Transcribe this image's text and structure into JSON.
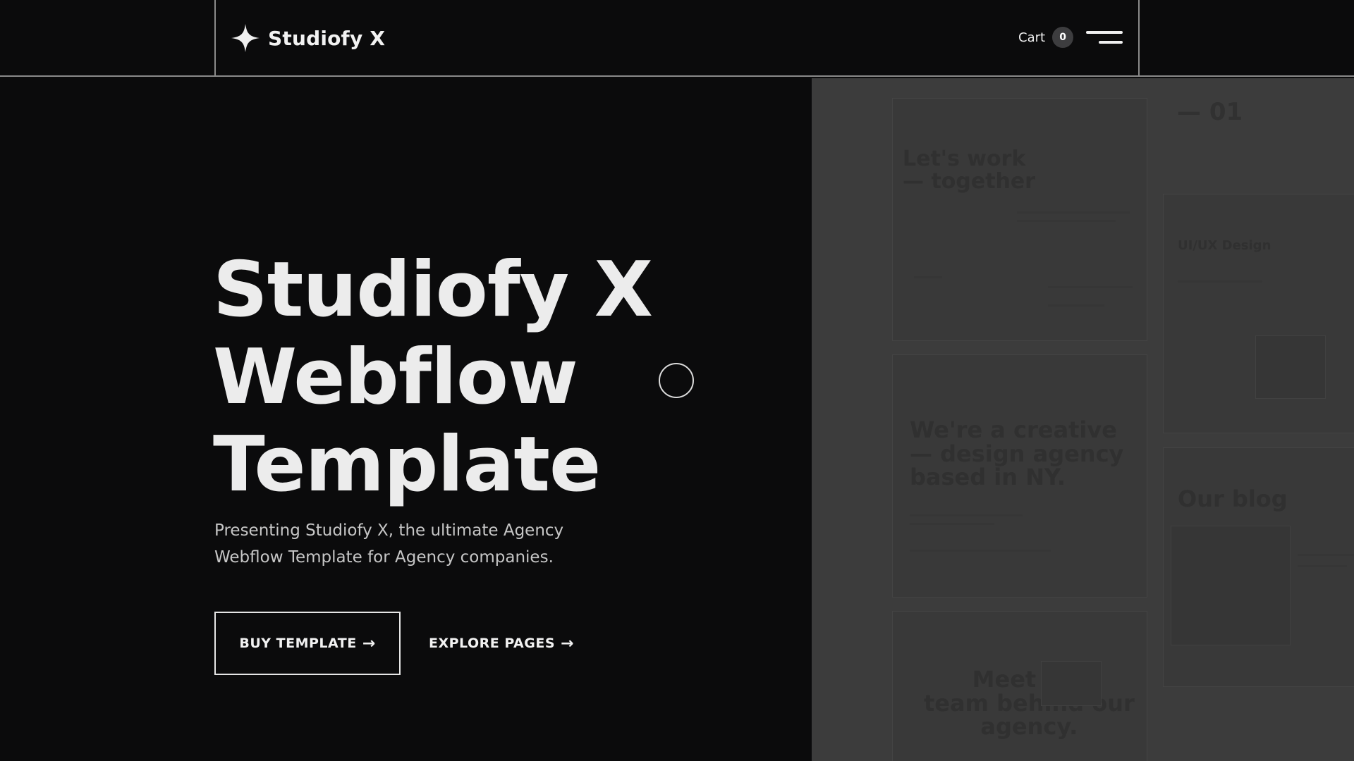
{
  "brand": {
    "name": "Studiofy X",
    "logo_icon": "four-point-star-icon"
  },
  "header": {
    "cart_label": "Cart",
    "cart_count": "0",
    "menu_icon": "hamburger-menu-icon"
  },
  "hero": {
    "title_lines": [
      "Studiofy X",
      "Webflow",
      "Template"
    ],
    "subtitle_lines": [
      "Presenting Studiofy X, the ultimate Agency",
      "Webflow Template for Agency companies."
    ],
    "buy_label": "BUY TEMPLATE",
    "explore_label": "EXPLORE PAGES",
    "arrow": "→"
  },
  "preview": {
    "card_1_title_lines": [
      "Let's work",
      "— together"
    ],
    "card_2_title_lines": [
      "We're a creative",
      "— design agency",
      "based in NY."
    ],
    "card_3_title_lines": [
      "Meet the",
      "team behind our",
      "agency."
    ],
    "side_number": "— 01",
    "side_service": "UI/UX Design",
    "side_blog_title": "Our blog"
  },
  "colors": {
    "background": "#0b0b0c",
    "panel": "#3c3c3c",
    "text": "#ececec",
    "divider": "#8a8a8a"
  }
}
